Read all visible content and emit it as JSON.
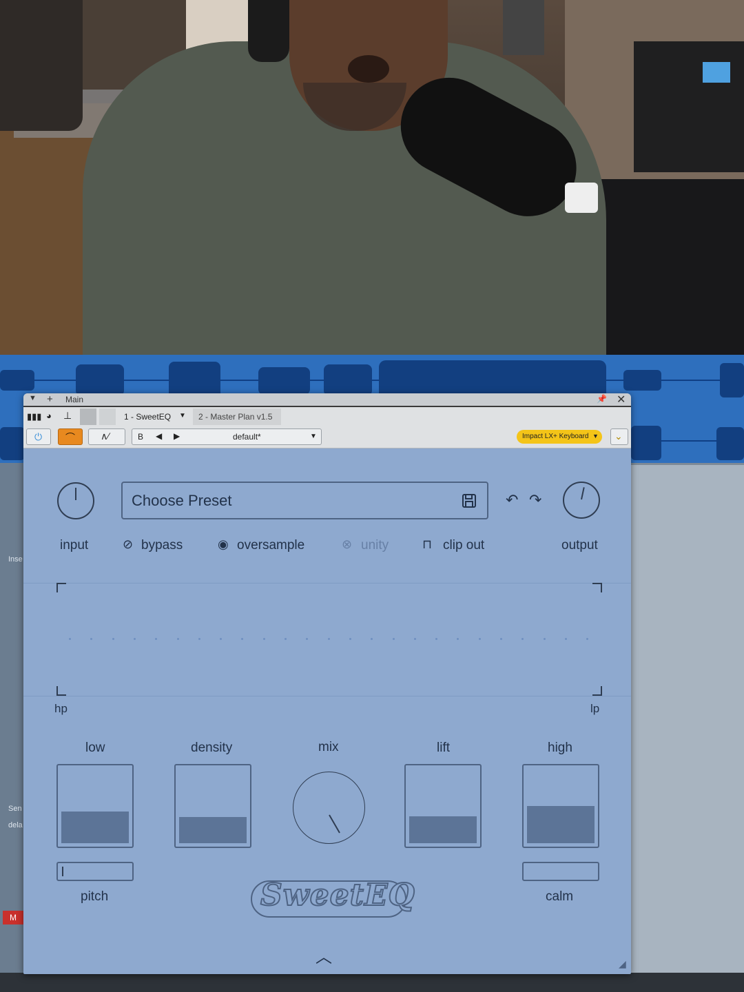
{
  "window": {
    "title": "Main",
    "slot_label": "1 - SweetEQ",
    "track_label": "2 - Master Plan v1.5",
    "preset_dropdown": "default*",
    "keyboard_badge": "Impact LX+ Keyboard",
    "compare_label": "B"
  },
  "plugin": {
    "preset_field": "Choose Preset",
    "labels": {
      "input": "input",
      "bypass": "bypass",
      "oversample": "oversample",
      "unity": "unity",
      "clip_out": "clip out",
      "output": "output",
      "hp": "hp",
      "lp": "lp",
      "low": "low",
      "density": "density",
      "mix": "mix",
      "lift": "lift",
      "high": "high",
      "pitch": "pitch",
      "calm": "calm"
    },
    "logo_text": "SweetEQ",
    "faders": {
      "low": 0.43,
      "density": 0.35,
      "lift": 0.36,
      "high": 0.5
    }
  },
  "daw_side": {
    "insert_label": "Inse",
    "send_label": "Sen",
    "delay_label": "dela",
    "mute_label": "M"
  },
  "colors": {
    "plugin_bg": "#8ea9cf",
    "fader_fill": "#5c7497",
    "waveform_bg": "#2e6fbd",
    "accent_orange": "#e8891f",
    "badge_yellow": "#f4c418"
  }
}
